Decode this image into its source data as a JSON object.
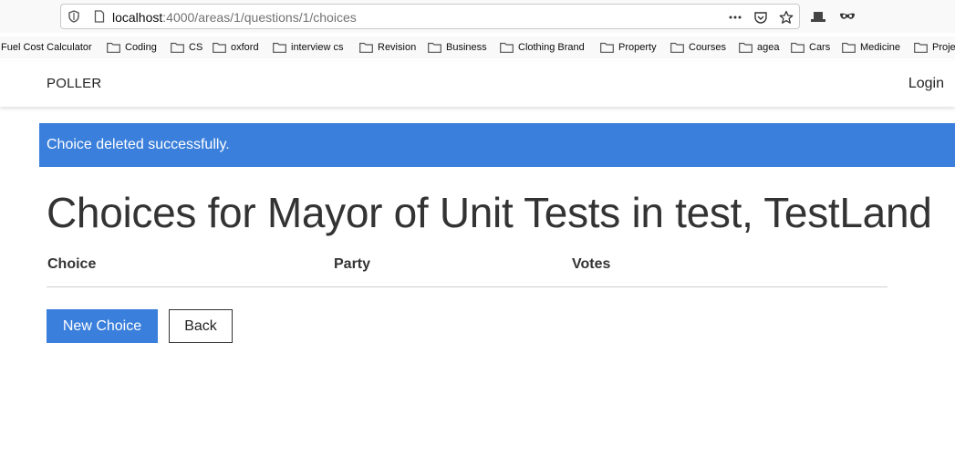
{
  "browser": {
    "url_host": "localhost",
    "url_path": ":4000/areas/1/questions/1/choices",
    "bookmarks": [
      {
        "label": "Fuel Cost Calculator",
        "folder": false
      },
      {
        "label": "Coding",
        "folder": true
      },
      {
        "label": "CS",
        "folder": true
      },
      {
        "label": "oxford",
        "folder": true
      },
      {
        "label": "interview cs",
        "folder": true
      },
      {
        "label": "Revision",
        "folder": true
      },
      {
        "label": "Business",
        "folder": true
      },
      {
        "label": "Clothing Brand",
        "folder": true
      },
      {
        "label": "Property",
        "folder": true
      },
      {
        "label": "Courses",
        "folder": true
      },
      {
        "label": "agea",
        "folder": true
      },
      {
        "label": "Cars",
        "folder": true
      },
      {
        "label": "Medicine",
        "folder": true
      },
      {
        "label": "Proje",
        "folder": true
      }
    ]
  },
  "nav": {
    "brand": "POLLER",
    "login": "Login"
  },
  "flash": {
    "message": "Choice deleted successfully.",
    "color": "#3a7fdb"
  },
  "page": {
    "title": "Choices for Mayor of Unit Tests in test, TestLand"
  },
  "table": {
    "headers": [
      "Choice",
      "Party",
      "Votes"
    ],
    "rows": []
  },
  "actions": {
    "new_choice": "New Choice",
    "back": "Back"
  }
}
